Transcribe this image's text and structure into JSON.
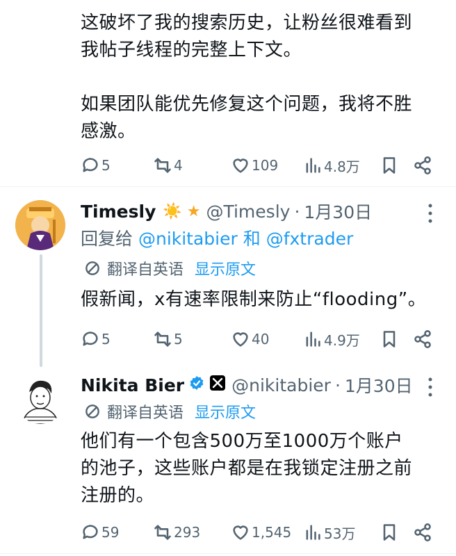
{
  "top_tweet": {
    "text_lines": [
      "这破坏了我的搜索历史，让粉丝很难看到",
      "我帖子线程的完整上下文。",
      "",
      "如果团队能优先修复这个问题，我将不胜",
      "感激。"
    ],
    "actions": {
      "replies": "5",
      "reposts": "4",
      "likes": "109",
      "views": "4.8万"
    }
  },
  "reply1": {
    "name": "Timesly",
    "name_emojis": "☀️ ★",
    "handle": "@Timesly",
    "separator": "·",
    "date": "1月30日",
    "reply_prefix": "回复给",
    "reply_mention1": "@nikitabier",
    "reply_and": "和",
    "reply_mention2": "@fxtrader",
    "translated_label": "翻译自英语",
    "show_original": "显示原文",
    "text": "假新闻，x有速率限制来防止“flooding”。",
    "actions": {
      "replies": "5",
      "reposts": "5",
      "likes": "40",
      "views": "4.9万"
    }
  },
  "reply2": {
    "name": "Nikita Bier",
    "handle": "@nikitabier",
    "separator": "·",
    "date": "1月30日",
    "translated_label": "翻译自英语",
    "show_original": "显示原文",
    "text_lines": [
      "他们有一个包含500万至1000万个账户",
      "的池子，这些账户都是在我锁定注册之前",
      "注册的。"
    ],
    "actions": {
      "replies": "59",
      "reposts": "293",
      "likes": "1,545",
      "views": "53万"
    }
  },
  "colors": {
    "accent": "#1d9bf0",
    "muted": "#536471",
    "text": "#0f1419",
    "verified": "#1d9bf0"
  }
}
